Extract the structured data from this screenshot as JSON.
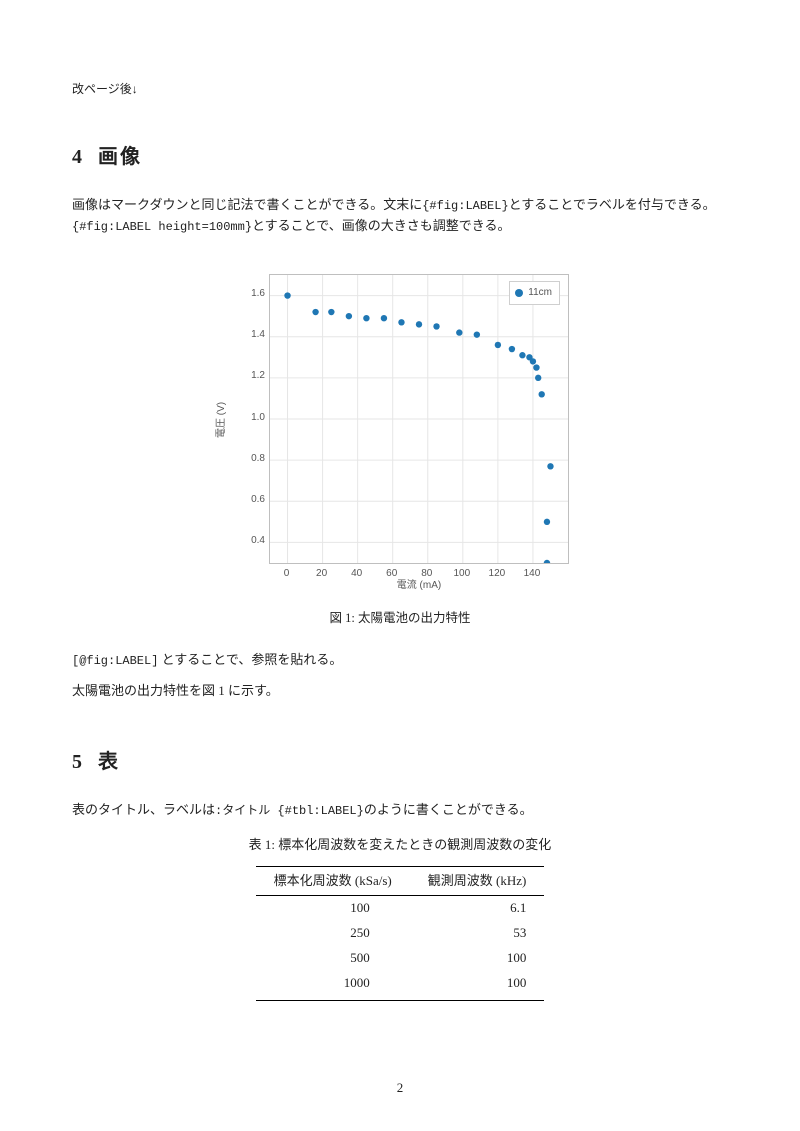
{
  "page_break_note": "改ページ後↓",
  "sec4": {
    "num": "4",
    "title": "画像",
    "p1a": "画像はマークダウンと同じ記法で書くことができる。文末に",
    "p1code1": "{#fig:LABEL}",
    "p1b": "とすることでラベルを付与できる。",
    "p1code2": "{#fig:LABEL height=100mm}",
    "p1c": "とすることで、画像の大きさも調整できる。"
  },
  "figure": {
    "caption_prefix": "図 1: ",
    "caption": "太陽電池の出力特性"
  },
  "after_fig": {
    "code": "[@fig:LABEL]",
    "text1": " とすることで、参照を貼れる。",
    "text2": "太陽電池の出力特性を図 1 に示す。"
  },
  "sec5": {
    "num": "5",
    "title": "表",
    "p1a": "表のタイトル、ラベルは",
    "p1code": ":タイトル {#tbl:LABEL}",
    "p1b": "のように書くことができる。"
  },
  "table": {
    "caption_prefix": "表 1: ",
    "caption": "標本化周波数を変えたときの観測周波数の変化",
    "headers": [
      "標本化周波数 (kSa/s)",
      "観測周波数 (kHz)"
    ],
    "rows": [
      [
        "100",
        "6.1"
      ],
      [
        "250",
        "53"
      ],
      [
        "500",
        "100"
      ],
      [
        "1000",
        "100"
      ]
    ]
  },
  "page_number": "2",
  "chart_data": {
    "type": "scatter",
    "title": "",
    "xlabel": "電流 (mA)",
    "ylabel": "電圧 (V)",
    "xlim": [
      -10,
      160
    ],
    "ylim": [
      0.3,
      1.7
    ],
    "xticks": [
      0,
      20,
      40,
      60,
      80,
      100,
      120,
      140
    ],
    "yticks": [
      0.4,
      0.6,
      0.8,
      1.0,
      1.2,
      1.4,
      1.6
    ],
    "legend": "11cm",
    "series": [
      {
        "name": "11cm",
        "x": [
          0,
          16,
          25,
          35,
          45,
          55,
          65,
          75,
          85,
          98,
          108,
          120,
          128,
          134,
          138,
          140,
          142,
          143,
          145,
          150,
          148,
          148
        ],
        "y": [
          1.6,
          1.52,
          1.52,
          1.5,
          1.49,
          1.49,
          1.47,
          1.46,
          1.45,
          1.42,
          1.41,
          1.36,
          1.34,
          1.31,
          1.3,
          1.28,
          1.25,
          1.2,
          1.12,
          0.77,
          0.5,
          0.3
        ]
      }
    ]
  }
}
